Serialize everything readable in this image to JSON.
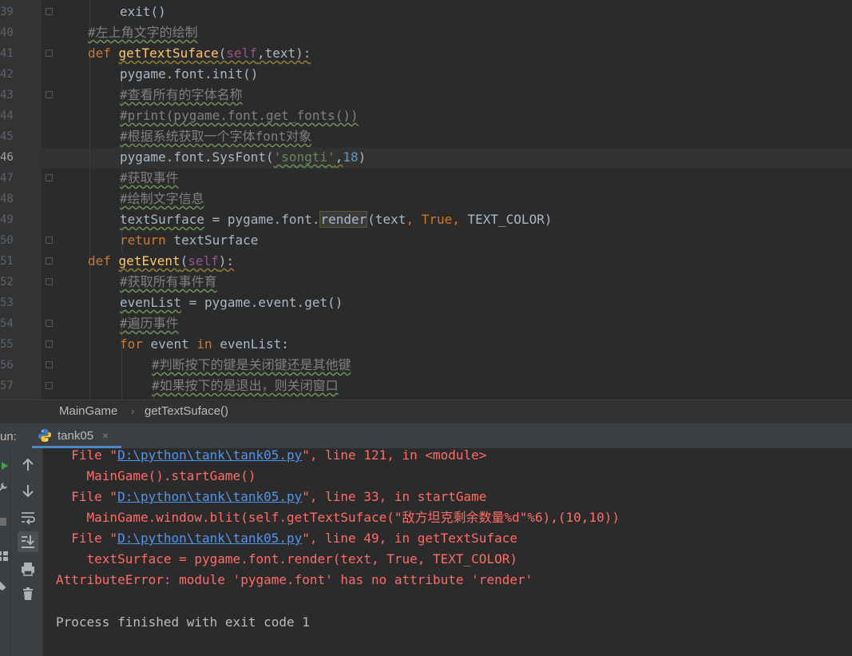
{
  "editor": {
    "line_numbers": [
      "39",
      "40",
      "41",
      "42",
      "43",
      "44",
      "45",
      "46",
      "47",
      "48",
      "49",
      "50",
      "51",
      "52",
      "53",
      "54",
      "55",
      "56",
      "57"
    ],
    "active_line": "46",
    "lines": {
      "l39": {
        "t1": "exit()"
      },
      "l40": {
        "t1": "#左上角文字的绘制"
      },
      "l41": {
        "kw": "def",
        "fn": "getTextSuface",
        "p1": "(",
        "self": "self",
        "p2": ",text):"
      },
      "l42": {
        "t1": "pygame.font.init()"
      },
      "l43": {
        "t1": "#查看所有的字体名称"
      },
      "l44": {
        "t1": "#print(pygame.font.get_fonts())"
      },
      "l45": {
        "t1": "#根据系统获取一个字体font对象"
      },
      "l46": {
        "t1": "pygame.font.SysFont(",
        "str": "'songti'",
        "c": ",",
        "num": "18",
        "t2": ")"
      },
      "l47": {
        "t1": "#获取事件"
      },
      "l48": {
        "t1": "#绘制文字信息"
      },
      "l49": {
        "t1": "textSurface",
        "t2": " = pygame.font.",
        "t3": "render",
        "t4": "(text",
        "c1": ", ",
        "kw1": "True",
        "c2": ", ",
        "t5": "TEXT_COLOR)"
      },
      "l50": {
        "kw": "return",
        "t1": " textSurface"
      },
      "l51": {
        "kw": "def",
        "fn": "getEvent",
        "p1": "(",
        "self": "self",
        "p2": "):"
      },
      "l52": {
        "t1": "#获取所有事件育"
      },
      "l53": {
        "t1": "evenList",
        "t2": " = pygame.event.get()"
      },
      "l54": {
        "t1": "#遍历事件"
      },
      "l55": {
        "kw": "for",
        "t1": " event ",
        "kw2": "in",
        "t2": " evenList:"
      },
      "l56": {
        "t1": "#判断按下的键是关闭键还是其他键"
      },
      "l57": {
        "t1": "#如果按下的是退出，则关闭窗口"
      }
    }
  },
  "breadcrumb": {
    "item1": "MainGame",
    "sep": "›",
    "item2": "getTextSuface()"
  },
  "run": {
    "label": "un:",
    "tab_name": "tank05",
    "tab_close": "×"
  },
  "console": {
    "lines": [
      {
        "pre": "  File \"",
        "link": "D:\\python\\tank\\tank05.py",
        "post": "\", line 121, in <module>"
      },
      {
        "text": "    MainGame().startGame()"
      },
      {
        "pre": "  File \"",
        "link": "D:\\python\\tank\\tank05.py",
        "post": "\", line 33, in startGame"
      },
      {
        "text": "    MainGame.window.blit(self.getTextSuface(\"敌方坦克剩余数量%d\"%6),(10,10))"
      },
      {
        "pre": "  File \"",
        "link": "D:\\python\\tank\\tank05.py",
        "post": "\", line 49, in getTextSuface"
      },
      {
        "text": "    textSurface = pygame.font.render(text, True, TEXT_COLOR)"
      },
      {
        "text": "AttributeError: module 'pygame.font' has no attribute 'render'"
      },
      {
        "text": ""
      },
      {
        "text": "Process finished with exit code 1"
      }
    ]
  },
  "colors": {
    "keyword": "#cc7832",
    "function": "#ffc66d",
    "self": "#94558d",
    "string": "#6a8759",
    "number": "#6897bb",
    "comment": "#808080",
    "error": "#ff6b68",
    "link": "#5394ec",
    "accent": "#4a88c7"
  }
}
